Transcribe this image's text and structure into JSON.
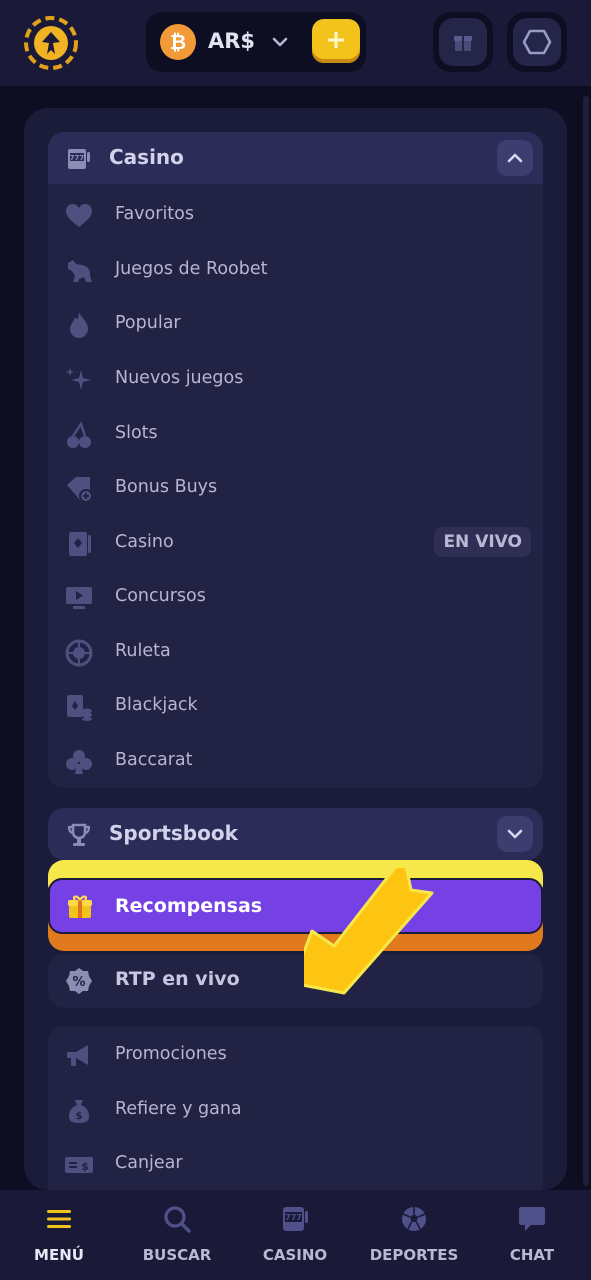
{
  "header": {
    "currency": "AR$",
    "add_label": "+"
  },
  "casino": {
    "title": "Casino",
    "items": [
      {
        "label": "Favoritos",
        "icon": "heart-icon"
      },
      {
        "label": "Juegos de Roobet",
        "icon": "kangaroo-icon"
      },
      {
        "label": "Popular",
        "icon": "flame-icon"
      },
      {
        "label": "Nuevos juegos",
        "icon": "sparkles-icon"
      },
      {
        "label": "Slots",
        "icon": "cherries-icon"
      },
      {
        "label": "Bonus Buys",
        "icon": "tag-plus-icon"
      },
      {
        "label": "Casino",
        "icon": "card-icon",
        "badge": "EN VIVO"
      },
      {
        "label": "Concursos",
        "icon": "monitor-play-icon"
      },
      {
        "label": "Ruleta",
        "icon": "roulette-icon"
      },
      {
        "label": "Blackjack",
        "icon": "chips-icon"
      },
      {
        "label": "Baccarat",
        "icon": "club-icon"
      }
    ]
  },
  "sportsbook": {
    "title": "Sportsbook"
  },
  "rewards": {
    "label": "Recompensas"
  },
  "rtp": {
    "label": "RTP en vivo"
  },
  "more": {
    "items": [
      {
        "label": "Promociones",
        "icon": "megaphone-icon"
      },
      {
        "label": "Refiere y gana",
        "icon": "money-bag-icon"
      },
      {
        "label": "Canjear",
        "icon": "voucher-icon"
      }
    ]
  },
  "bottom_nav": [
    {
      "label": "MENÚ",
      "icon": "hamburger-icon",
      "active": true
    },
    {
      "label": "BUSCAR",
      "icon": "search-icon"
    },
    {
      "label": "CASINO",
      "icon": "slot-777-icon"
    },
    {
      "label": "DEPORTES",
      "icon": "soccer-ball-icon"
    },
    {
      "label": "CHAT",
      "icon": "chat-bubble-icon"
    }
  ],
  "colors": {
    "background": "#14142a",
    "panel": "#1b1b3a",
    "accent_purple": "#7540e4",
    "accent_yellow": "#f3c21b",
    "bitcoin": "#f29a37"
  }
}
